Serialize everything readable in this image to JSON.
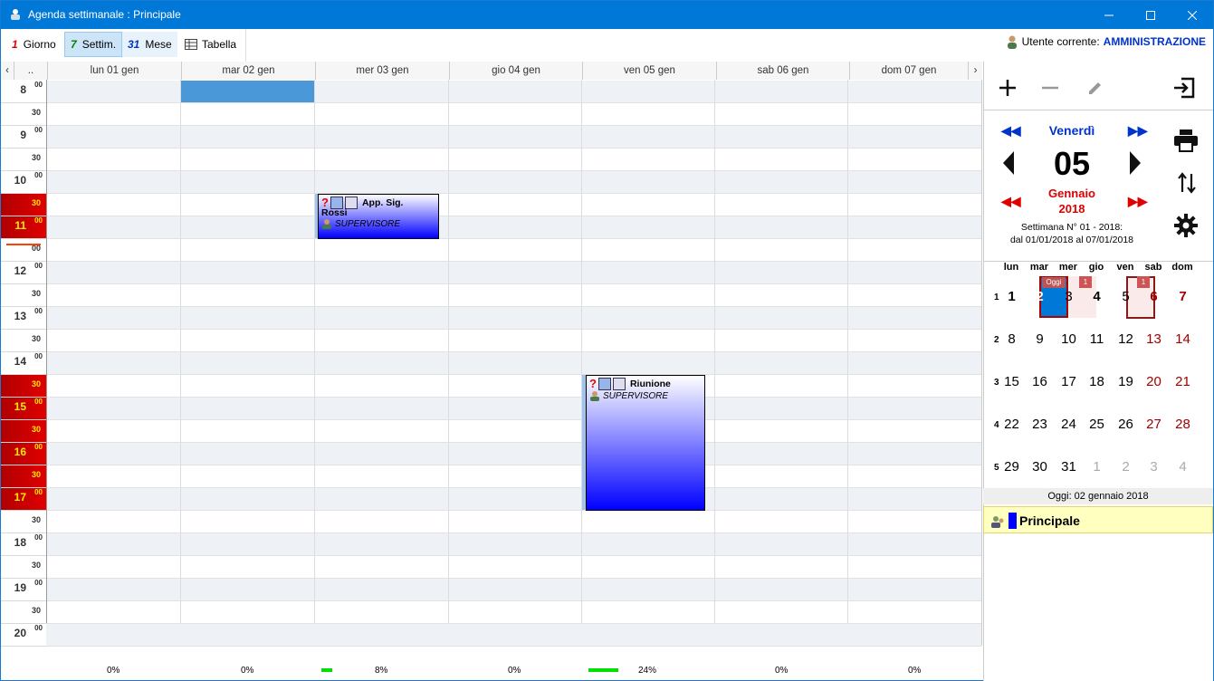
{
  "window": {
    "title": "Agenda settimanale : Principale"
  },
  "toolbar": {
    "giorno": {
      "num": "1",
      "label": "Giorno"
    },
    "settim": {
      "num": "7",
      "label": "Settim."
    },
    "mese": {
      "num": "31",
      "label": "Mese"
    },
    "tabella": {
      "label": "Tabella"
    },
    "user_label": "Utente corrente:",
    "user_value": "AMMINISTRAZIONE"
  },
  "grid": {
    "corner": "..",
    "days": [
      "lun 01 gen",
      "mar 02 gen",
      "mer 03 gen",
      "gio 04 gen",
      "ven 05 gen",
      "sab 06 gen",
      "dom 07 gen"
    ],
    "times": [
      {
        "h": "8",
        "m": "00"
      },
      {
        "h": "",
        "m": "30"
      },
      {
        "h": "9",
        "m": "00"
      },
      {
        "h": "",
        "m": "30"
      },
      {
        "h": "10",
        "m": "00"
      },
      {
        "h": "",
        "m": "30"
      },
      {
        "h": "11",
        "m": "00"
      },
      {
        "h": "",
        "m": "00"
      },
      {
        "h": "12",
        "m": "00"
      },
      {
        "h": "",
        "m": "30"
      },
      {
        "h": "13",
        "m": "00"
      },
      {
        "h": "",
        "m": "30"
      },
      {
        "h": "14",
        "m": "00"
      },
      {
        "h": "",
        "m": "30"
      },
      {
        "h": "15",
        "m": "00"
      },
      {
        "h": "",
        "m": "30"
      },
      {
        "h": "16",
        "m": "00"
      },
      {
        "h": "",
        "m": "30"
      },
      {
        "h": "17",
        "m": "00"
      },
      {
        "h": "",
        "m": "30"
      },
      {
        "h": "18",
        "m": "00"
      },
      {
        "h": "",
        "m": "30"
      },
      {
        "h": "19",
        "m": "00"
      },
      {
        "h": "",
        "m": "30"
      },
      {
        "h": "20",
        "m": "00"
      }
    ],
    "events": [
      {
        "title": "App. Sig.",
        "title2": "Rossi",
        "user": "SUPERVISORE",
        "q": "?"
      },
      {
        "title": "Riunione",
        "user": "SUPERVISORE",
        "q": "?"
      }
    ],
    "stats": [
      "0%",
      "0%",
      "8%",
      "0%",
      "24%",
      "0%",
      "0%"
    ]
  },
  "panel": {
    "weekday": "Venerdì",
    "day": "05",
    "month": "Gennaio",
    "year": "2018",
    "week_line1": "Settimana N° 01 - 2018:",
    "week_line2": "dal 01/01/2018 al 07/01/2018",
    "cal_headers": [
      "lun",
      "mar",
      "mer",
      "gio",
      "ven",
      "sab",
      "dom"
    ],
    "weeks": [
      {
        "n": "1",
        "days": [
          "1",
          "2",
          "3",
          "4",
          "5",
          "6",
          "7"
        ]
      },
      {
        "n": "2",
        "days": [
          "8",
          "9",
          "10",
          "11",
          "12",
          "13",
          "14"
        ]
      },
      {
        "n": "3",
        "days": [
          "15",
          "16",
          "17",
          "18",
          "19",
          "20",
          "21"
        ]
      },
      {
        "n": "4",
        "days": [
          "22",
          "23",
          "24",
          "25",
          "26",
          "27",
          "28"
        ]
      },
      {
        "n": "5",
        "days": [
          "29",
          "30",
          "31",
          "1",
          "2",
          "3",
          "4"
        ]
      }
    ],
    "oggi_badge": "Oggi",
    "count_badge_mer": "1",
    "count_badge_ven": "1",
    "today_line": "Oggi:  02 gennaio 2018",
    "agenda_name": "Principale",
    "agenda_color": "#0000ff"
  },
  "colors": {
    "accent": "#0078d7",
    "event_blue": "#0000ff",
    "busy_red": "#c00000",
    "stat_bar": "#00e000"
  }
}
